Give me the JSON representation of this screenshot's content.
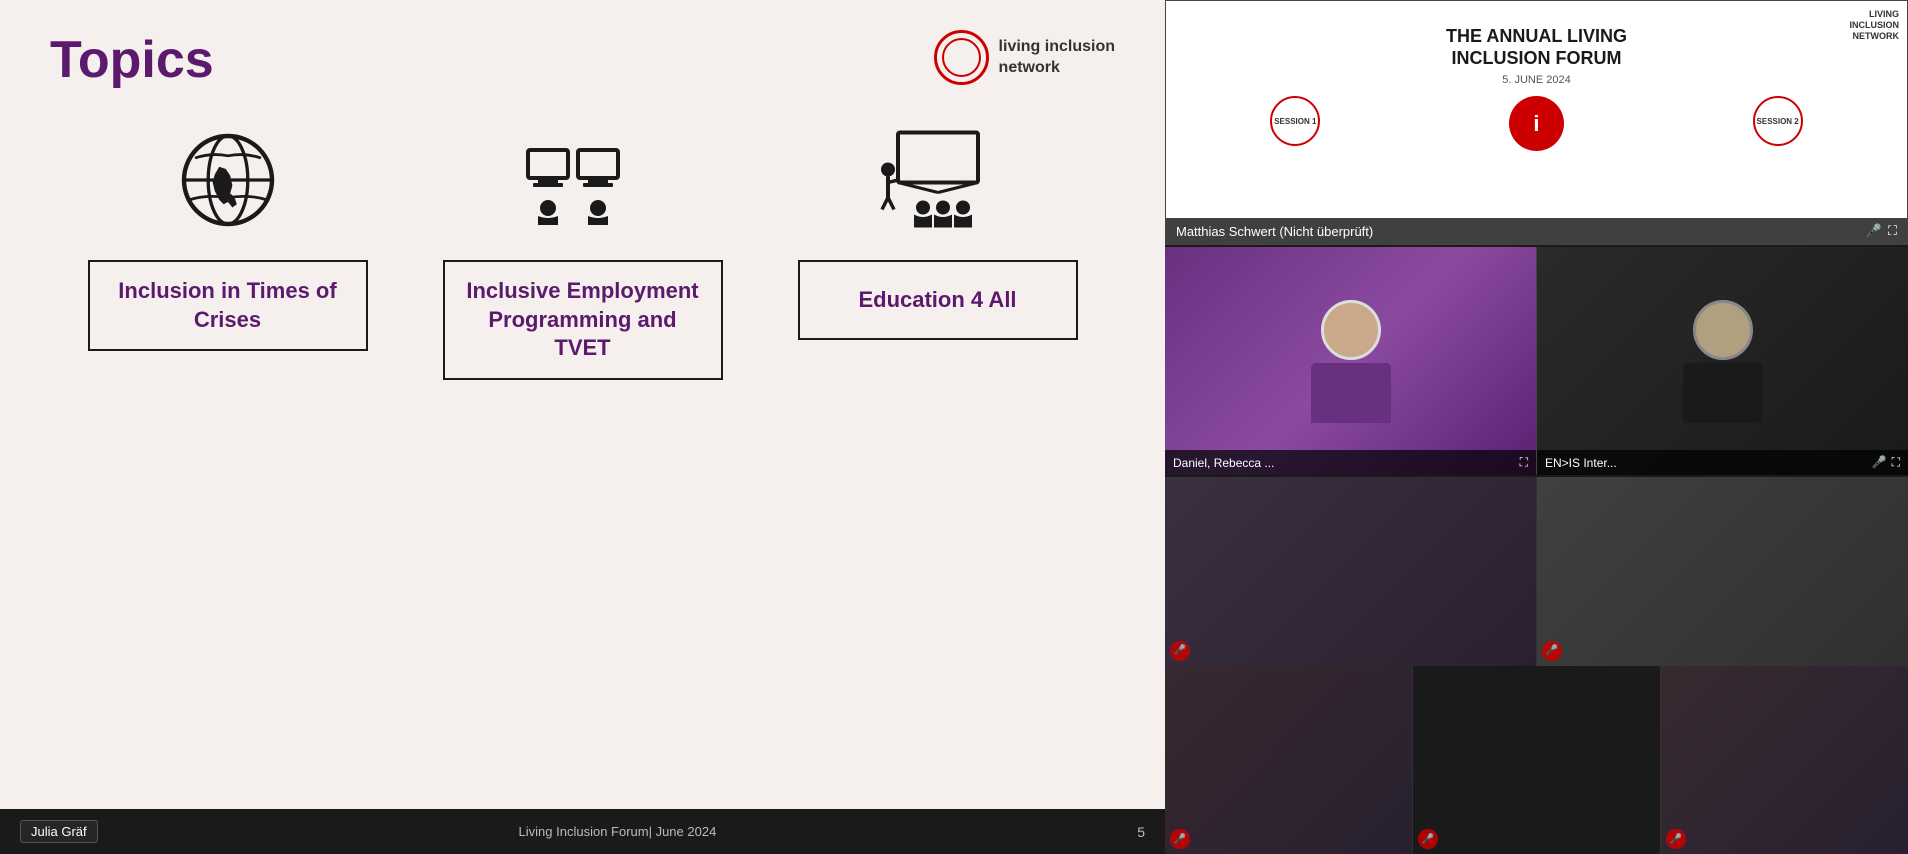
{
  "slide": {
    "title": "Topics",
    "background_color": "#f5f0ed",
    "logo": {
      "text_line1": "living inclusion",
      "text_line2": "network"
    },
    "topics": [
      {
        "id": "topic-1",
        "icon": "globe",
        "label": "Inclusion in Times of Crises"
      },
      {
        "id": "topic-2",
        "icon": "classroom",
        "label": "Inclusive Employment Programming and TVET"
      },
      {
        "id": "topic-3",
        "icon": "teaching",
        "label": "Education 4 All"
      }
    ],
    "footer": {
      "presenter": "Julia Gräf",
      "event": "Living Inclusion Forum| June 2024",
      "page": "5"
    }
  },
  "participants": {
    "top": {
      "name": "Matthias Schwert (Nicht überprüft)",
      "sketchnote_title": "THE ANNUAL LIVING INCLUSION FORUM",
      "sketchnote_date": "5. JUNE 2024",
      "network_label": "LIVING INCLUSION NETWORK"
    },
    "mid_left": {
      "name": "Daniel, Rebecca ...",
      "muted": false
    },
    "mid_right": {
      "name": "EN>IS Inter...",
      "muted": false
    },
    "small": [
      {
        "id": "s1",
        "muted": true
      },
      {
        "id": "s2",
        "muted": true
      },
      {
        "id": "s3",
        "muted": false
      },
      {
        "id": "s4",
        "muted": false
      },
      {
        "id": "s5",
        "muted": true
      },
      {
        "id": "s6",
        "muted": false
      }
    ]
  },
  "icons": {
    "mic_off": "🎤",
    "expand": "⛶",
    "mic": "🎤"
  }
}
